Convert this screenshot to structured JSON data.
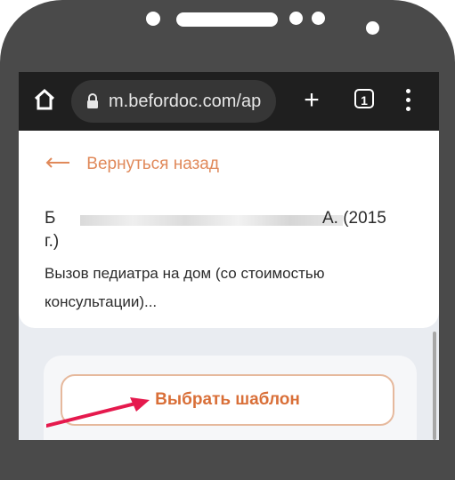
{
  "browser": {
    "url": "m.befordoc.com/ap",
    "tab_count": "1"
  },
  "page": {
    "back_label": "Вернуться назад",
    "name_start": "Б",
    "name_end": "А. (2015",
    "name_line2": "г.)",
    "description": "Вызов педиатра на дом (со стоимостью консультации)...",
    "choose_button": "Выбрать шаблон"
  },
  "colors": {
    "accent": "#d96f38",
    "arrow": "#e5194d"
  }
}
